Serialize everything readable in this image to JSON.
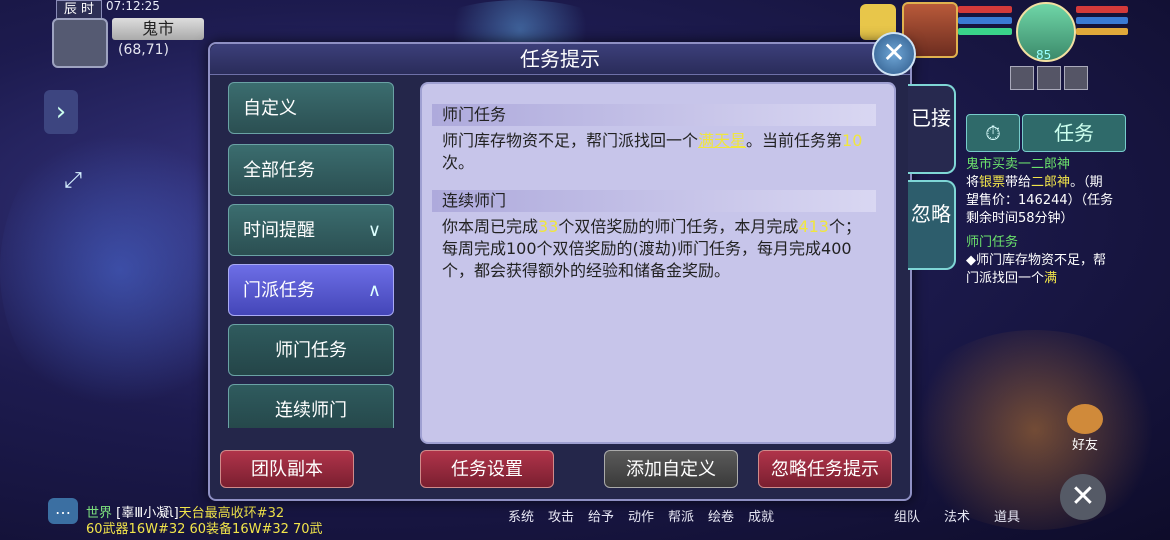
{
  "hud": {
    "time_label": "辰 时",
    "clock": "07:12:25",
    "location": "鬼市",
    "coordinates": "(68,71)",
    "player_level": "85"
  },
  "dialog": {
    "title": "任务提示",
    "nav": [
      {
        "label": "自定义"
      },
      {
        "label": "全部任务"
      },
      {
        "label": "时间提醒",
        "chevron": "∨"
      },
      {
        "label": "门派任务",
        "chevron": "∧"
      },
      {
        "label": "师门任务"
      },
      {
        "label": "连续师门"
      }
    ],
    "sections": [
      {
        "heading": "师门任务",
        "body_before": "师门库存物资不足，帮门派找回一个",
        "highlight": "满天星",
        "body_mid": "。当前任务第",
        "highlight2": "10",
        "body_after": "次。"
      },
      {
        "heading": "连续师门",
        "p1": "你本周已完成",
        "n1": "33",
        "p2": "个双倍奖励的师门任务，本月完成",
        "n2": "413",
        "p3": "个；每周完成100个双倍奖励的(渡劫)师门任务，每月完成400个，都会获得额外的经验和储备金奖励。"
      }
    ],
    "buttons": {
      "team_dungeon": "团队副本",
      "task_settings": "任务设置",
      "add_custom": "添加自定义",
      "ignore_hint": "忽略任务提示"
    },
    "side_tabs": {
      "accepted": "已接",
      "ignored": "忽略"
    }
  },
  "task_tracker": {
    "tab_label": "任务",
    "quest1_title": "鬼市买卖一二郎神",
    "quest1_p1": "将",
    "quest1_item": "银票",
    "quest1_p2": "带给",
    "quest1_npc": "二郎神",
    "quest1_p3": "。（期望售价：146244）（任务剩余时间58分钟）",
    "quest2_title": "师门任务",
    "quest2_p1": "◆师门库存物资不足，帮门派找回一个",
    "quest2_item": "满"
  },
  "chat": {
    "channel": "世界",
    "line1_prefix": "[",
    "line1_name": "辜Ⅲ小凝ὶ]",
    "line1_msg": "天台最高收环#32",
    "line2": "60武器16W#32 60装备16W#32 70武"
  },
  "bottom_actions": [
    "系统",
    "攻击",
    "给予",
    "动作",
    "帮派",
    "绘卷",
    "成就"
  ],
  "bottom_actions2": [
    "组队",
    "法术",
    "道具"
  ],
  "friends_label": "好友"
}
